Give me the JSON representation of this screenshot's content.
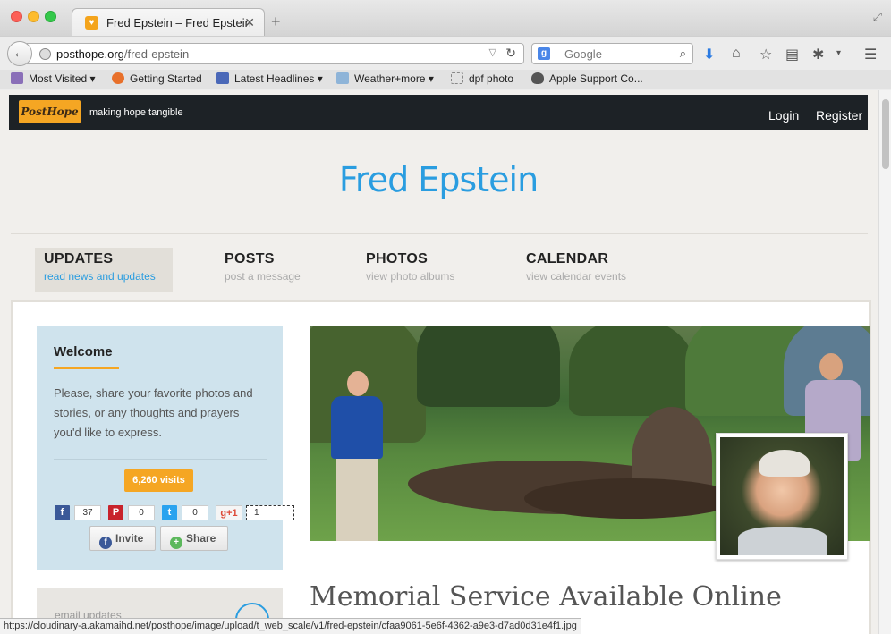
{
  "browser": {
    "tab_title": "Fred Epstein – Fred Epstein",
    "url_domain": "posthope.org",
    "url_path": "/fred-epstein",
    "search_engine": "Google",
    "bookmarks": [
      "Most Visited",
      "Getting Started",
      "Latest Headlines",
      "Weather+more",
      "dpf photo",
      "Apple Support Co..."
    ],
    "status_url": "https://cloudinary-a.akamaihd.net/posthope/image/upload/t_web_scale/v1/fred-epstein/cfaa9061-5e6f-4362-a9e3-d7ad0d31e4f1.jpg"
  },
  "site": {
    "logo": "PostHope",
    "tagline": "making hope tangible",
    "login": "Login",
    "register": "Register"
  },
  "page": {
    "title": "Fred Epstein",
    "tabs": [
      {
        "name": "UPDATES",
        "sub": "read news and updates"
      },
      {
        "name": "POSTS",
        "sub": "post a message"
      },
      {
        "name": "PHOTOS",
        "sub": "view photo albums"
      },
      {
        "name": "CALENDAR",
        "sub": "view calendar events"
      }
    ]
  },
  "welcome": {
    "title": "Welcome",
    "text": "Please, share your favorite photos and stories, or any thoughts and prayers you'd like to express.",
    "visits": "6,260 visits",
    "facebook_count": "37",
    "pinterest_count": "0",
    "twitter_count": "0",
    "gplus_label": "g+1",
    "gplus_count": "1",
    "invite_label": "Invite",
    "share_label": "Share"
  },
  "post": {
    "title": "Memorial Service Available Online"
  },
  "email": {
    "label": "email updates"
  },
  "colors": {
    "accent_blue": "#2a9de0",
    "brand_orange": "#f5a623",
    "header_dark": "#1d2226"
  }
}
